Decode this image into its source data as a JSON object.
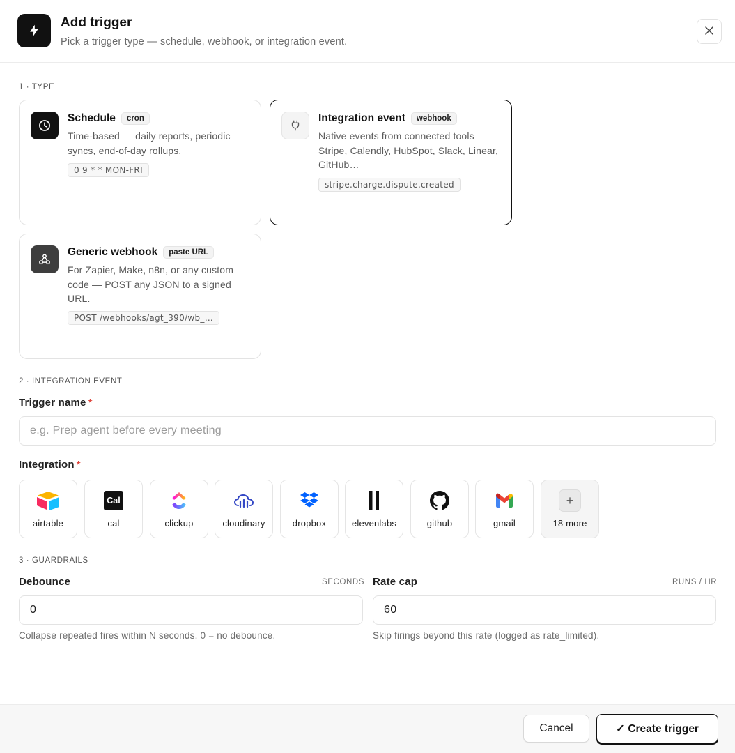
{
  "dialog": {
    "title": "Add trigger",
    "subtitle": "Pick a trigger type — schedule, webhook, or integration event.",
    "close_icon": "close-icon",
    "header_icon": "lightning-bolt-icon"
  },
  "sections": {
    "type": "1 · TYPE",
    "integration_event": "2 · INTEGRATION EVENT",
    "guardrails": "3 · GUARDRAILS"
  },
  "types": [
    {
      "title": "Schedule",
      "badge": "cron",
      "description": "Time-based — daily reports, periodic syncs, end-of-day rollups.",
      "example": "0 9 * * MON-FRI",
      "icon": "clock-icon",
      "selected": false
    },
    {
      "title": "Integration event",
      "badge": "webhook",
      "description": "Native events from connected tools — Stripe, Calendly, HubSpot, Slack, Linear, GitHub…",
      "example": "stripe.charge.dispute.created",
      "icon": "plug-icon",
      "selected": true
    },
    {
      "title": "Generic webhook",
      "badge": "paste URL",
      "description": "For Zapier, Make, n8n, or any custom code — POST any JSON to a signed URL.",
      "example": "POST /webhooks/agt_390/wb_…",
      "icon": "webhook-icon",
      "selected": false
    }
  ],
  "trigger_name": {
    "label": "Trigger name",
    "required_mark": "*",
    "placeholder": "e.g. Prep agent before every meeting",
    "value": ""
  },
  "integration": {
    "label": "Integration",
    "required_mark": "*",
    "items": [
      {
        "name": "airtable",
        "icon": "airtable-icon"
      },
      {
        "name": "cal",
        "icon": "cal-icon",
        "logo_text": "Cal"
      },
      {
        "name": "clickup",
        "icon": "clickup-icon"
      },
      {
        "name": "cloudinary",
        "icon": "cloudinary-icon"
      },
      {
        "name": "dropbox",
        "icon": "dropbox-icon"
      },
      {
        "name": "elevenlabs",
        "icon": "elevenlabs-icon"
      },
      {
        "name": "github",
        "icon": "github-icon"
      },
      {
        "name": "gmail",
        "icon": "gmail-icon"
      }
    ],
    "more": {
      "label": "18 more",
      "icon": "plus-icon",
      "symbol": "+"
    }
  },
  "guardrails": {
    "debounce": {
      "label": "Debounce",
      "unit": "SECONDS",
      "value": "0",
      "help": "Collapse repeated fires within N seconds. 0 = no debounce."
    },
    "rate_cap": {
      "label": "Rate cap",
      "unit": "RUNS / HR",
      "value": "60",
      "help": "Skip firings beyond this rate (logged as rate_limited)."
    }
  },
  "footer": {
    "cancel_label": "Cancel",
    "create_label": "✓ Create trigger"
  },
  "colors": {
    "accent": "#111111",
    "required": "#e0483f",
    "muted_text": "#6b6b6b"
  }
}
